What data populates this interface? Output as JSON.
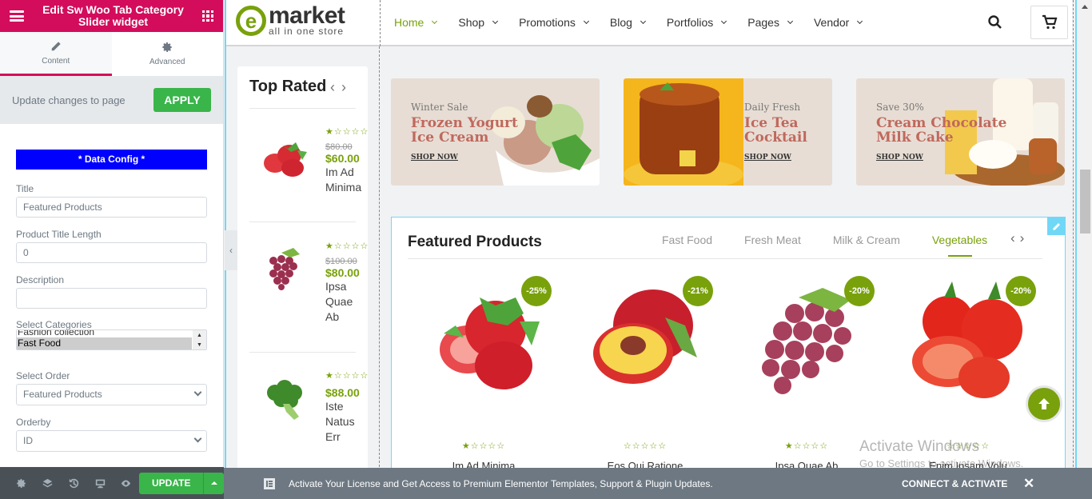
{
  "panel": {
    "title": "Edit Sw Woo Tab Category Slider widget",
    "tabs": [
      {
        "label": "Content",
        "icon": "pencil-icon",
        "active": true
      },
      {
        "label": "Advanced",
        "icon": "gear-icon",
        "active": false
      }
    ],
    "apply_bar": {
      "text": "Update changes to page",
      "button": "APPLY"
    },
    "section_heading": "* Data Config *",
    "controls": {
      "title": {
        "label": "Title",
        "value": "Featured Products"
      },
      "title_length": {
        "label": "Product Title Length",
        "value": "0"
      },
      "description": {
        "label": "Description",
        "value": ""
      },
      "categories": {
        "label": "Select Categories",
        "options": [
          "Fashion collection",
          "Fast Food"
        ],
        "selected": "Fast Food"
      },
      "order": {
        "label": "Select Order",
        "value": "Featured Products"
      },
      "orderby": {
        "label": "Orderby",
        "value": "ID"
      }
    },
    "footer": {
      "icons": [
        "settings-icon",
        "layers-icon",
        "history-icon",
        "responsive-icon",
        "preview-eye-icon"
      ],
      "update_label": "UPDATE"
    }
  },
  "site": {
    "logo": {
      "letter": "e",
      "brand": "market",
      "tagline": "all in one store"
    },
    "nav": [
      {
        "label": "Home",
        "active": true
      },
      {
        "label": "Shop",
        "active": false
      },
      {
        "label": "Promotions",
        "active": false
      },
      {
        "label": "Blog",
        "active": false
      },
      {
        "label": "Portfolios",
        "active": false
      },
      {
        "label": "Pages",
        "active": false
      },
      {
        "label": "Vendor",
        "active": false
      }
    ],
    "accent_color": "#79a10b"
  },
  "top_rated": {
    "title": "Top Rated",
    "items": [
      {
        "rating": 1,
        "old_price": "$80.00",
        "price": "$60.00",
        "name": "Im Ad Minima",
        "image": "strawberry"
      },
      {
        "rating": 1,
        "old_price": "$100.00",
        "price": "$80.00",
        "name": "Ipsa Quae Ab",
        "image": "grapes"
      },
      {
        "rating": 1,
        "old_price": "",
        "price": "$88.00",
        "name": "Iste Natus Err",
        "image": "broccoli"
      }
    ]
  },
  "banners": [
    {
      "subtitle": "Winter Sale",
      "title_line1": "Frozen Yogurt",
      "title_line2": "Ice Cream",
      "link": "SHOP NOW",
      "image": "ice-cream"
    },
    {
      "subtitle": "Daily Fresh",
      "title_line1": "Ice Tea",
      "title_line2": "Cocktail",
      "link": "SHOP NOW",
      "image": "ice-tea"
    },
    {
      "subtitle": "Save 30%",
      "title_line1": "Cream Chocolate",
      "title_line2": "Milk Cake",
      "link": "SHOP NOW",
      "image": "milk-cheese"
    }
  ],
  "featured": {
    "title": "Featured Products",
    "tabs": [
      {
        "label": "Fast Food",
        "active": false
      },
      {
        "label": "Fresh Meat",
        "active": false
      },
      {
        "label": "Milk & Cream",
        "active": false
      },
      {
        "label": "Vegetables",
        "active": true
      }
    ],
    "products": [
      {
        "badge": "-25%",
        "rating": 1,
        "name": "Im Ad Minima",
        "image": "strawberry"
      },
      {
        "badge": "-21%",
        "rating": 0,
        "name": "Eos Qui Ratione",
        "image": "peach"
      },
      {
        "badge": "-20%",
        "rating": 1,
        "name": "Ipsa Quae Ab",
        "image": "grapes"
      },
      {
        "badge": "-20%",
        "rating": 0,
        "name": "Enim Ipsam Volu",
        "image": "tomato"
      }
    ]
  },
  "watermark": {
    "line1": "Activate Windows",
    "line2": "Go to Settings to activate Windows."
  },
  "notice": {
    "message": "Activate Your License and Get Access to Premium Elementor Templates, Support & Plugin Updates.",
    "action": "CONNECT & ACTIVATE"
  }
}
